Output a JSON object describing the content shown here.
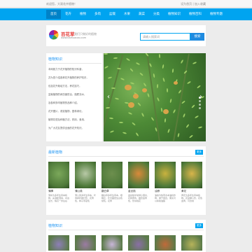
{
  "topbar": {
    "welcome": "欢迎您，大观花卉植物！",
    "links": "设为首页 | 加入收藏"
  },
  "nav": [
    "首页",
    "花卉",
    "植物",
    "多肉",
    "盆栽",
    "水果",
    "蔬菜",
    "分类",
    "植物知识",
    "植物百科",
    "植物专题"
  ],
  "header": {
    "logo_name": "百花草",
    "logo_url": "www.baihuacao.com",
    "tagline": "我们只做好的植物",
    "search_placeholder": "请输入搜索词",
    "search_button": "搜索"
  },
  "intro": {
    "title": "植物知识",
    "lines": [
      "本网致力于花卉植物的知识科普，",
      "并为您介绍各种花卉植物的养护知识，",
      "包括花卉栽培方法，养花技巧，",
      "盆栽植物的病虫害防治，施肥浇水，",
      "及各种多肉植物的品种介绍，",
      "花卉图片，观赏植物，园林绿化，",
      "植物花语及种植方法，药用，食用，",
      "为广大花友提供全面的花卉知识。"
    ]
  },
  "hot": {
    "title": "最新植物",
    "more": "更多",
    "cards": [
      {
        "name": "蒲棒",
        "desc": "蒲棒为多年生草本植物，喜温暖湿润，水边生长，株高一米左右",
        "color": "#7ba85a"
      },
      {
        "name": "蒲公英",
        "desc": "蒲公英多年生草本，叶倒卵状披针形，花黄色，种子带冠毛",
        "color": "#b8c9a6"
      },
      {
        "name": "翻白草",
        "desc": "翻白草多年生草本，根粗壮，叶背面密生白色绒毛，花黄",
        "color": "#6d8f4e"
      },
      {
        "name": "金丝桃",
        "desc": "金丝桃半常绿小灌木，花鲜黄色，雄蕊金黄色，形似桃花",
        "color": "#d98a3a"
      },
      {
        "name": "油棕",
        "desc": "油棕为热带木本油料作物，单干挺直，果实可以榨取油脂",
        "color": "#c9b23e"
      },
      {
        "name": "黄花",
        "desc": "黄花为多年生草本植物，花冠漏斗形，花色金黄，可食用",
        "color": "#d9b54a"
      }
    ]
  },
  "knowledge": {
    "title": "植物知识",
    "more": "更多",
    "colors": [
      "#8e7fb8",
      "#9c7ba3",
      "#c9b6d8",
      "#8a6fa6",
      "#c06a3a",
      "#b6b35a"
    ]
  }
}
